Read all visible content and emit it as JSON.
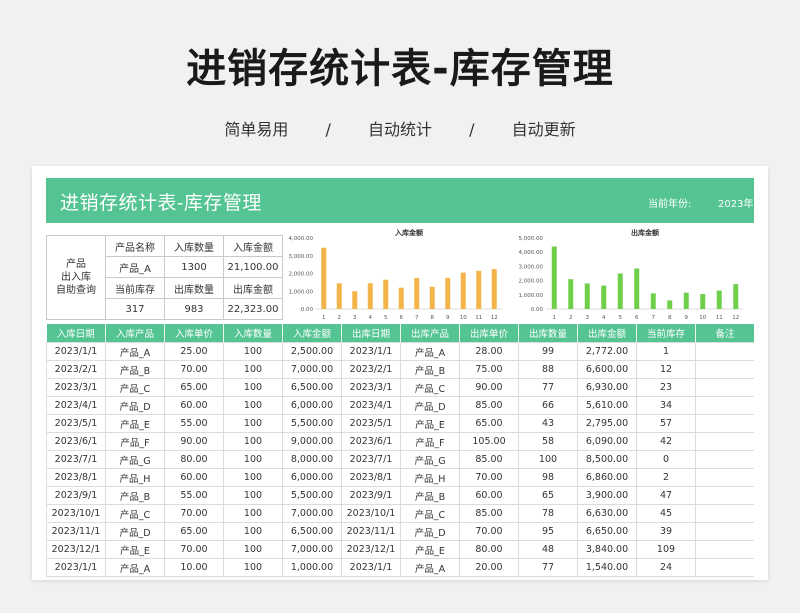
{
  "poster": {
    "title": "进销存统计表-库存管理",
    "taglines": [
      "简单易用",
      "/",
      "自动统计",
      "/",
      "自动更新"
    ]
  },
  "sheet": {
    "banner_title": "进销存统计表-库存管理",
    "date_label": "当前年份:",
    "date_value": "2023年",
    "accent_color": "#55c493"
  },
  "summary": {
    "query_label": [
      "产品",
      "出入库",
      "自助查询"
    ],
    "headers_row1": [
      "产品名称",
      "入库数量",
      "入库金额"
    ],
    "values_row1": [
      "产品_A",
      "1300",
      "21,100.00"
    ],
    "headers_row2": [
      "当前库存",
      "出库数量",
      "出库金额"
    ],
    "values_row2": [
      "317",
      "983",
      "22,323.00"
    ]
  },
  "chart_data": [
    {
      "type": "bar",
      "title": "入库金额",
      "color": "#f3b54a",
      "categories": [
        "1",
        "2",
        "3",
        "4",
        "5",
        "6",
        "7",
        "8",
        "9",
        "10",
        "11",
        "12"
      ],
      "values": [
        3450,
        1450,
        1000,
        1450,
        1650,
        1200,
        1750,
        1250,
        1750,
        2050,
        2150,
        2250
      ],
      "ylim": [
        0,
        4000
      ],
      "yticks": [
        "4,000.00",
        "3,000.00",
        "2,000.00",
        "1,000.00",
        "0.00"
      ]
    },
    {
      "type": "bar",
      "title": "出库金额",
      "color": "#6fcf4a",
      "categories": [
        "1",
        "2",
        "3",
        "4",
        "5",
        "6",
        "7",
        "8",
        "9",
        "10",
        "11",
        "12"
      ],
      "values": [
        4400,
        2100,
        1800,
        1650,
        2500,
        2850,
        1100,
        600,
        1150,
        1050,
        1300,
        1750
      ],
      "ylim": [
        0,
        5000
      ],
      "yticks": [
        "5,000.00",
        "4,000.00",
        "3,000.00",
        "2,000.00",
        "1,000.00",
        "0.00"
      ]
    }
  ],
  "table": {
    "columns": [
      "入库日期",
      "入库产品",
      "入库单价",
      "入库数量",
      "入库金额",
      "出库日期",
      "出库产品",
      "出库单价",
      "出库数量",
      "出库金额",
      "当前库存",
      "备注"
    ],
    "rows": [
      [
        "2023/1/1",
        "产品_A",
        "25.00",
        "100",
        "2,500.00",
        "2023/1/1",
        "产品_A",
        "28.00",
        "99",
        "2,772.00",
        "1",
        ""
      ],
      [
        "2023/2/1",
        "产品_B",
        "70.00",
        "100",
        "7,000.00",
        "2023/2/1",
        "产品_B",
        "75.00",
        "88",
        "6,600.00",
        "12",
        ""
      ],
      [
        "2023/3/1",
        "产品_C",
        "65.00",
        "100",
        "6,500.00",
        "2023/3/1",
        "产品_C",
        "90.00",
        "77",
        "6,930.00",
        "23",
        ""
      ],
      [
        "2023/4/1",
        "产品_D",
        "60.00",
        "100",
        "6,000.00",
        "2023/4/1",
        "产品_D",
        "85.00",
        "66",
        "5,610.00",
        "34",
        ""
      ],
      [
        "2023/5/1",
        "产品_E",
        "55.00",
        "100",
        "5,500.00",
        "2023/5/1",
        "产品_E",
        "65.00",
        "43",
        "2,795.00",
        "57",
        ""
      ],
      [
        "2023/6/1",
        "产品_F",
        "90.00",
        "100",
        "9,000.00",
        "2023/6/1",
        "产品_F",
        "105.00",
        "58",
        "6,090.00",
        "42",
        ""
      ],
      [
        "2023/7/1",
        "产品_G",
        "80.00",
        "100",
        "8,000.00",
        "2023/7/1",
        "产品_G",
        "85.00",
        "100",
        "8,500.00",
        "0",
        ""
      ],
      [
        "2023/8/1",
        "产品_H",
        "60.00",
        "100",
        "6,000.00",
        "2023/8/1",
        "产品_H",
        "70.00",
        "98",
        "6,860.00",
        "2",
        ""
      ],
      [
        "2023/9/1",
        "产品_B",
        "55.00",
        "100",
        "5,500.00",
        "2023/9/1",
        "产品_B",
        "60.00",
        "65",
        "3,900.00",
        "47",
        ""
      ],
      [
        "2023/10/1",
        "产品_C",
        "70.00",
        "100",
        "7,000.00",
        "2023/10/1",
        "产品_C",
        "85.00",
        "78",
        "6,630.00",
        "45",
        ""
      ],
      [
        "2023/11/1",
        "产品_D",
        "65.00",
        "100",
        "6,500.00",
        "2023/11/1",
        "产品_D",
        "70.00",
        "95",
        "6,650.00",
        "39",
        ""
      ],
      [
        "2023/12/1",
        "产品_E",
        "70.00",
        "100",
        "7,000.00",
        "2023/12/1",
        "产品_E",
        "80.00",
        "48",
        "3,840.00",
        "109",
        ""
      ],
      [
        "2023/1/1",
        "产品_A",
        "10.00",
        "100",
        "1,000.00",
        "2023/1/1",
        "产品_A",
        "20.00",
        "77",
        "1,540.00",
        "24",
        ""
      ]
    ]
  }
}
